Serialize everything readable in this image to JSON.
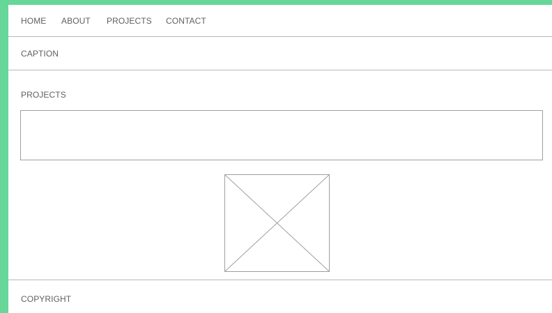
{
  "nav": {
    "items": [
      {
        "label": "HOME"
      },
      {
        "label": "ABOUT"
      },
      {
        "label": "PROJECTS"
      },
      {
        "label": "CONTACT"
      }
    ]
  },
  "caption": {
    "text": "CAPTION"
  },
  "projects": {
    "title": "PROJECTS",
    "text_box_value": "",
    "image_icon": "image-placeholder-icon"
  },
  "footer": {
    "text": "COPYRIGHT"
  },
  "colors": {
    "frame": "#67d699",
    "page_bg": "#ffffff",
    "text": "#5f5f5f",
    "rule": "#b7b7b7"
  }
}
